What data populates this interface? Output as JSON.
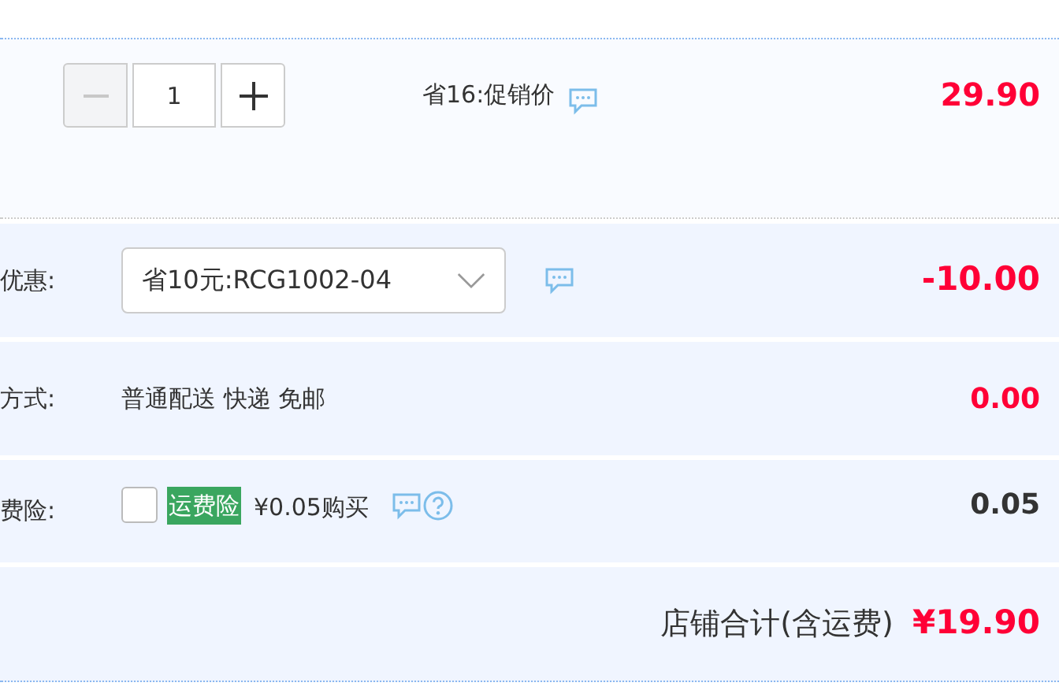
{
  "item": {
    "quantity": {
      "minus_disabled": true,
      "value": "1"
    },
    "promo": "省16:促销价",
    "price": "29.90"
  },
  "rows": [
    {
      "kind": "select",
      "label": "优惠:",
      "value": "省10元:RCG1002-04",
      "amount": "-10.00",
      "emphasis": true
    },
    {
      "kind": "text",
      "label": "方式:",
      "value": "普通配送 快递 免邮",
      "amount": "0.00",
      "emphasis": true
    },
    {
      "kind": "checkbox",
      "label": "费险:",
      "checked": false,
      "tag": "运费险",
      "value": "¥0.05购买",
      "amount": "0.05",
      "emphasis": false
    }
  ],
  "total": {
    "label": "店铺合计(含运费)",
    "amount": "¥19.90"
  }
}
